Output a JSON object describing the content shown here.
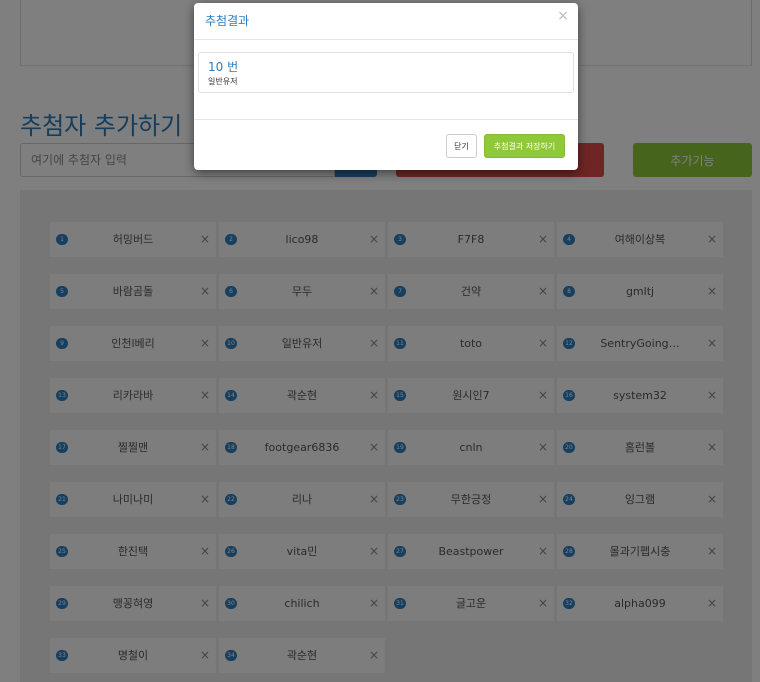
{
  "page": {
    "title": "추첨자 추가하기",
    "input_placeholder": "여기에 추첨자 입력",
    "extra_button_label": "추가기능"
  },
  "participants": [
    {
      "number": "1",
      "name": "허밍버드"
    },
    {
      "number": "2",
      "name": "lico98"
    },
    {
      "number": "3",
      "name": "F7F8"
    },
    {
      "number": "4",
      "name": "여해이상복"
    },
    {
      "number": "5",
      "name": "바람곰돌"
    },
    {
      "number": "6",
      "name": "무두"
    },
    {
      "number": "7",
      "name": "건약"
    },
    {
      "number": "8",
      "name": "gmltj"
    },
    {
      "number": "9",
      "name": "인천l베리"
    },
    {
      "number": "10",
      "name": "일반유저"
    },
    {
      "number": "11",
      "name": "toto"
    },
    {
      "number": "12",
      "name": "SentryGoing…"
    },
    {
      "number": "13",
      "name": "리카라바"
    },
    {
      "number": "14",
      "name": "곽순현"
    },
    {
      "number": "15",
      "name": "원시인7"
    },
    {
      "number": "16",
      "name": "system32"
    },
    {
      "number": "17",
      "name": "찔찔맨"
    },
    {
      "number": "18",
      "name": "footgear6836"
    },
    {
      "number": "19",
      "name": "cnln"
    },
    {
      "number": "20",
      "name": "홈런볼"
    },
    {
      "number": "21",
      "name": "나미나미"
    },
    {
      "number": "22",
      "name": "리나"
    },
    {
      "number": "23",
      "name": "무한긍정"
    },
    {
      "number": "24",
      "name": "잉그램"
    },
    {
      "number": "25",
      "name": "한진택"
    },
    {
      "number": "26",
      "name": "vita민"
    },
    {
      "number": "27",
      "name": "Beastpower"
    },
    {
      "number": "28",
      "name": "몰과기펩시충"
    },
    {
      "number": "29",
      "name": "맹꽁혀영"
    },
    {
      "number": "30",
      "name": "chilich"
    },
    {
      "number": "31",
      "name": "글고운"
    },
    {
      "number": "32",
      "name": "alpha099"
    },
    {
      "number": "33",
      "name": "명철이"
    },
    {
      "number": "34",
      "name": "곽순현"
    }
  ],
  "modal": {
    "title": "추첨결과",
    "close_glyph": "×",
    "result": {
      "number": "10 번",
      "name": "일반유저"
    },
    "close_label": "닫기",
    "save_label": "추첨결과 저장하기"
  },
  "icons": {
    "remove": "×"
  },
  "colors": {
    "accent": "#2b7bbd",
    "green": "#8fc93a",
    "red": "#e04b4b",
    "badge": "#2f7fc1"
  }
}
